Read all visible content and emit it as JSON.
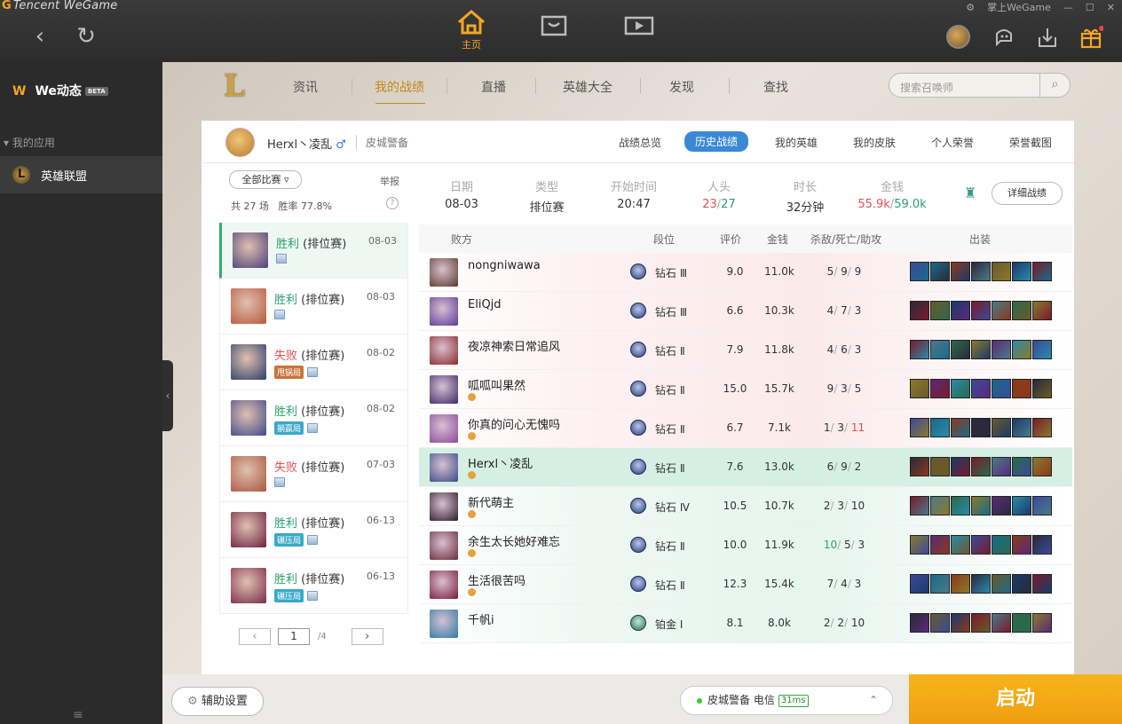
{
  "app": {
    "brand": "Tencent WeGame",
    "mobile_link": "掌上WeGame"
  },
  "top_nav": {
    "home_label": "主页"
  },
  "sidebar": {
    "we_label": "We动态",
    "beta": "BETA",
    "my_apps": "我的应用",
    "game": "英雄联盟"
  },
  "game_nav": {
    "tabs": [
      "资讯",
      "我的战绩",
      "直播",
      "英雄大全",
      "发现",
      "查找"
    ],
    "active_tab": "我的战绩",
    "search_placeholder": "搜索召唤师"
  },
  "profile": {
    "name": "Herxl丶凌乱",
    "server": "皮城警备",
    "tabs": [
      "战绩总览",
      "历史战绩",
      "我的英雄",
      "我的皮肤",
      "个人荣誉",
      "荣誉截图"
    ],
    "active_tab": "历史战绩"
  },
  "game_list": {
    "filter": "全部比赛",
    "report": "举报",
    "total": "共 27 场",
    "winrate": "胜率 77.8%",
    "help": "?",
    "games": [
      {
        "result": "胜利",
        "mode": "(排位赛)",
        "date": "08-03",
        "win": true,
        "tag": ""
      },
      {
        "result": "胜利",
        "mode": "(排位赛)",
        "date": "08-03",
        "win": true,
        "tag": ""
      },
      {
        "result": "失败",
        "mode": "(排位赛)",
        "date": "08-02",
        "win": false,
        "tag": "甩锅局"
      },
      {
        "result": "胜利",
        "mode": "(排位赛)",
        "date": "08-02",
        "win": true,
        "tag": "躺赢局"
      },
      {
        "result": "失败",
        "mode": "(排位赛)",
        "date": "07-03",
        "win": false,
        "tag": ""
      },
      {
        "result": "胜利",
        "mode": "(排位赛)",
        "date": "06-13",
        "win": true,
        "tag": "碾压局"
      },
      {
        "result": "胜利",
        "mode": "(排位赛)",
        "date": "06-13",
        "win": true,
        "tag": "碾压局"
      }
    ],
    "page": "1",
    "pages": "/4"
  },
  "match": {
    "date_label": "日期",
    "date": "08-03",
    "type_label": "类型",
    "type": "排位赛",
    "start_label": "开始时间",
    "start": "20:47",
    "kills_label": "人头",
    "kills_a": "23",
    "kills_b": "27",
    "duration_label": "时长",
    "duration": "32分钟",
    "gold_label": "金钱",
    "gold_a": "55.9k",
    "gold_b": "59.0k",
    "detail_button": "详细战绩"
  },
  "table_headers": {
    "team": "败方",
    "rank": "段位",
    "score": "评价",
    "gold": "金钱",
    "kda": "杀敌/死亡/助攻",
    "items": "出装"
  },
  "players": [
    {
      "name": "nongniwawa",
      "rank": "钻石 Ⅲ",
      "score": "9.0",
      "gold": "11.0k",
      "k": "5",
      "d": "9",
      "a": "9",
      "side": "loss"
    },
    {
      "name": "EliQjd",
      "rank": "钻石 Ⅲ",
      "score": "6.6",
      "gold": "10.3k",
      "k": "4",
      "d": "7",
      "a": "3",
      "side": "loss"
    },
    {
      "name": "夜凉神索日常追风",
      "rank": "钻石 Ⅱ",
      "score": "7.9",
      "gold": "11.8k",
      "k": "4",
      "d": "6",
      "a": "3",
      "side": "loss"
    },
    {
      "name": "呱呱叫果然",
      "rank": "钻石 Ⅱ",
      "score": "15.0",
      "gold": "15.7k",
      "k": "9",
      "d": "3",
      "a": "5",
      "side": "loss"
    },
    {
      "name": "你真的问心无愧吗",
      "rank": "钻石 Ⅱ",
      "score": "6.7",
      "gold": "7.1k",
      "k": "1",
      "d": "3",
      "a": "11",
      "side": "loss"
    },
    {
      "name": "Herxl丶凌乱",
      "rank": "钻石 Ⅱ",
      "score": "7.6",
      "gold": "13.0k",
      "k": "6",
      "d": "9",
      "a": "2",
      "side": "me"
    },
    {
      "name": "新代萌主",
      "rank": "钻石 Ⅳ",
      "score": "10.5",
      "gold": "10.7k",
      "k": "2",
      "d": "3",
      "a": "10",
      "side": "win"
    },
    {
      "name": "余生太长她好难忘",
      "rank": "钻石 Ⅱ",
      "score": "10.0",
      "gold": "11.9k",
      "k": "10",
      "d": "5",
      "a": "3",
      "side": "win"
    },
    {
      "name": "生活很苦吗",
      "rank": "钻石 Ⅱ",
      "score": "12.3",
      "gold": "15.4k",
      "k": "7",
      "d": "4",
      "a": "3",
      "side": "win"
    },
    {
      "name": "千帆i",
      "rank": "铂金 Ⅰ",
      "score": "8.1",
      "gold": "8.0k",
      "k": "2",
      "d": "2",
      "a": "10",
      "side": "win"
    }
  ],
  "bottom": {
    "assist": "辅助设置",
    "server": "皮城警备 电信",
    "ping": "31ms",
    "launch": "启动"
  },
  "colors": {
    "accent": "#f5a623",
    "win": "#2aa06a",
    "loss": "#e05050",
    "tab_active": "#3a89d6"
  }
}
